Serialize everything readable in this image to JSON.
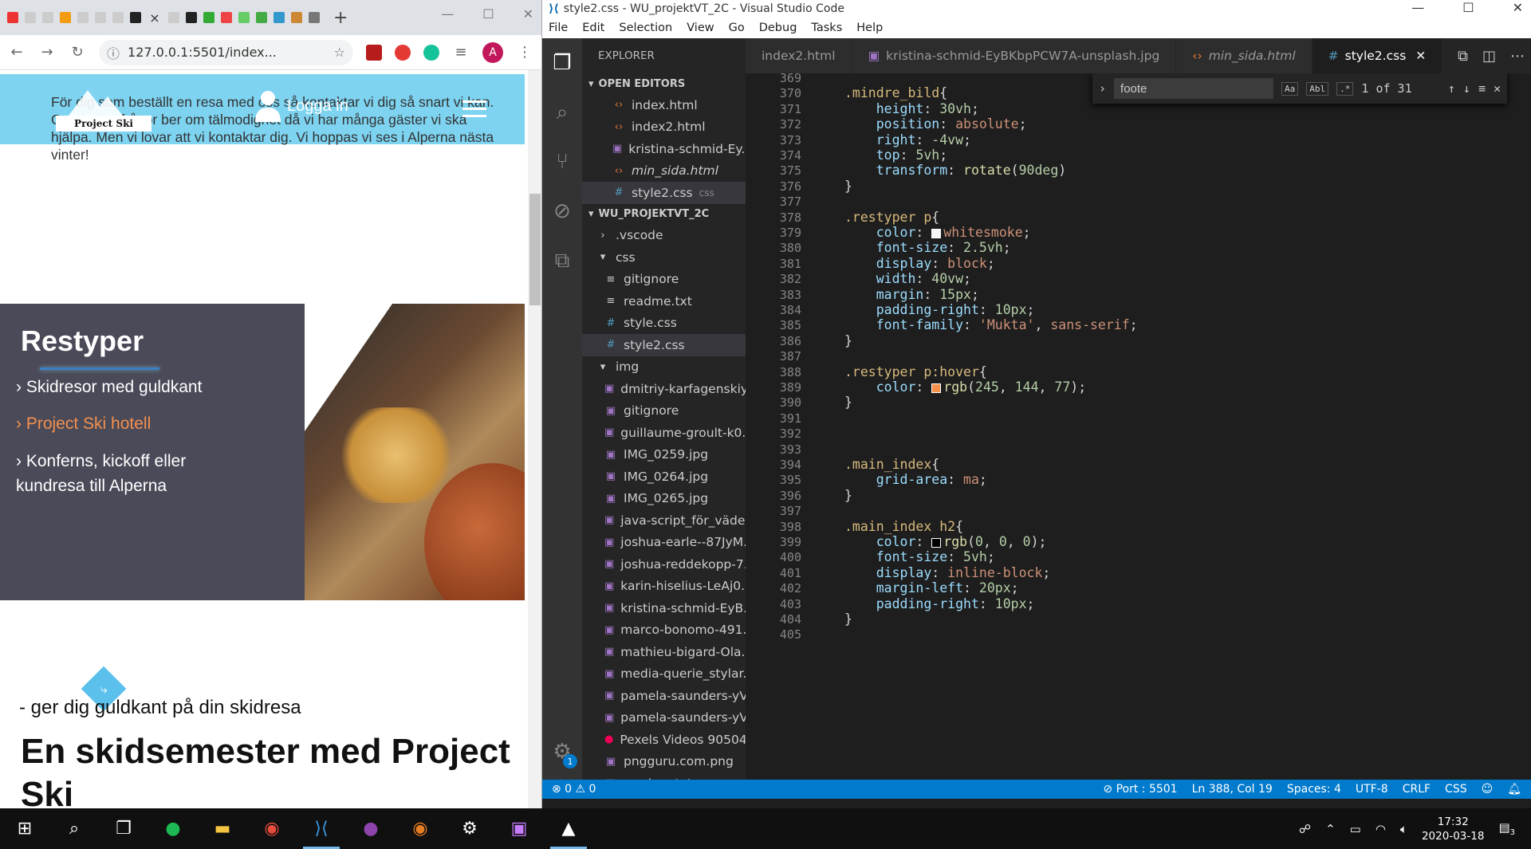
{
  "browser": {
    "url": "127.0.0.1:5501/index...",
    "account_initial": "A",
    "tab_close": "×",
    "new_tab": "+"
  },
  "page": {
    "top_text": "För dig som beställt en resa med oss så kontaktar vi dig så snart vi kan. Om du har frågor ber om tälmodighet då vi har många gäster vi ska hjälpa. Men vi lovar att vi kontaktar dig. Vi hoppas vi ses i Alperna nästa vinter!",
    "logo_text": "Project Ski",
    "login_label": "Logga in",
    "restyper_title": "Restyper",
    "restyper_items": [
      {
        "label": "Skidresor med guldkant",
        "color": "#ffffff"
      },
      {
        "label": "Project Ski hotell",
        "color": "#f5904d"
      },
      {
        "label": "Konferns, kickoff eller",
        "color": "#ffffff"
      },
      {
        "label": "kundresa till Alperna",
        "color": "#ffffff"
      }
    ],
    "tagline": "- ger dig guldkant på din skidresa",
    "headline": "En skidsemester med Project Ski"
  },
  "vscode": {
    "window_title": "style2.css - WU_projektVT_2C - Visual Studio Code",
    "menu": [
      "File",
      "Edit",
      "Selection",
      "View",
      "Go",
      "Debug",
      "Tasks",
      "Help"
    ],
    "explorer_title": "EXPLORER",
    "open_editors_label": "OPEN EDITORS",
    "project_label": "WU_PROJEKTVT_2C",
    "open_editors": [
      {
        "name": "index.html",
        "icon": "html"
      },
      {
        "name": "index2.html",
        "icon": "html"
      },
      {
        "name": "kristina-schmid-Ey...",
        "icon": "image"
      },
      {
        "name": "min_sida.html",
        "icon": "html"
      },
      {
        "name": "style2.css",
        "icon": "css",
        "hint": "css"
      }
    ],
    "tree": [
      {
        "name": ".vscode",
        "icon": "folder-closed",
        "indent": 1
      },
      {
        "name": "css",
        "icon": "folder-open",
        "indent": 1
      },
      {
        "name": "gitignore",
        "icon": "lines",
        "indent": 2
      },
      {
        "name": "readme.txt",
        "icon": "lines",
        "indent": 2
      },
      {
        "name": "style.css",
        "icon": "css",
        "indent": 2
      },
      {
        "name": "style2.css",
        "icon": "css",
        "indent": 2
      },
      {
        "name": "img",
        "icon": "folder-open",
        "indent": 1
      },
      {
        "name": "dmitriy-karfagenskiy...",
        "icon": "image",
        "indent": 2
      },
      {
        "name": "gitignore",
        "icon": "image",
        "indent": 2
      },
      {
        "name": "guillaume-groult-k0...",
        "icon": "image",
        "indent": 2
      },
      {
        "name": "IMG_0259.jpg",
        "icon": "image",
        "indent": 2
      },
      {
        "name": "IMG_0264.jpg",
        "icon": "image",
        "indent": 2
      },
      {
        "name": "IMG_0265.jpg",
        "icon": "image",
        "indent": 2
      },
      {
        "name": "java-script_för_väde...",
        "icon": "image",
        "indent": 2
      },
      {
        "name": "joshua-earle--87JyM...",
        "icon": "image",
        "indent": 2
      },
      {
        "name": "joshua-reddekopp-7...",
        "icon": "image",
        "indent": 2
      },
      {
        "name": "karin-hiselius-LeAj0...",
        "icon": "image",
        "indent": 2
      },
      {
        "name": "kristina-schmid-EyB...",
        "icon": "image",
        "indent": 2
      },
      {
        "name": "marco-bonomo-491...",
        "icon": "image",
        "indent": 2
      },
      {
        "name": "mathieu-bigard-Ola...",
        "icon": "image",
        "indent": 2
      },
      {
        "name": "media-querie_stylar...",
        "icon": "image",
        "indent": 2
      },
      {
        "name": "pamela-saunders-yV...",
        "icon": "image",
        "indent": 2
      },
      {
        "name": "pamela-saunders-yV...",
        "icon": "image",
        "indent": 2
      },
      {
        "name": "Pexels Videos 90504...",
        "icon": "video",
        "indent": 2
      },
      {
        "name": "pngguru.com.png",
        "icon": "image",
        "indent": 2
      },
      {
        "name": "readme.txt",
        "icon": "image",
        "indent": 2
      }
    ],
    "tabs": [
      {
        "label": "index2.html",
        "italic": false,
        "active": false
      },
      {
        "label": "kristina-schmid-EyBKbpPCW7A-unsplash.jpg",
        "italic": false,
        "active": false
      },
      {
        "label": "min_sida.html",
        "italic": true,
        "active": false
      },
      {
        "label": "style2.css",
        "italic": false,
        "active": true
      }
    ],
    "find": {
      "query": "foote",
      "result": "1 of 31",
      "opt_case": "Aa",
      "opt_word": "Abl",
      "opt_regex": ".*"
    },
    "code": [
      {
        "n": "369",
        "html": ""
      },
      {
        "n": "370",
        "html": "<span class='sel-c'>.mindre_bild</span>{"
      },
      {
        "n": "371",
        "html": "    <span class='prop'>height</span>: <span class='num'>30vh</span>;"
      },
      {
        "n": "372",
        "html": "    <span class='prop'>position</span>: <span class='val'>absolute</span>;"
      },
      {
        "n": "373",
        "html": "    <span class='prop'>right</span>: <span class='num'>-4vw</span>;"
      },
      {
        "n": "374",
        "html": "    <span class='prop'>top</span>: <span class='num'>5vh</span>;"
      },
      {
        "n": "375",
        "html": "    <span class='prop'>transform</span>: <span class='fn'>rotate</span>(<span class='num'>90deg</span>)"
      },
      {
        "n": "376",
        "html": "}"
      },
      {
        "n": "377",
        "html": ""
      },
      {
        "n": "378",
        "html": "<span class='sel-c'>.restyper p</span>{"
      },
      {
        "n": "379",
        "html": "    <span class='prop'>color</span>: <span class='sw' style='background:#f5f5f5'></span><span class='val'>whitesmoke</span>;"
      },
      {
        "n": "380",
        "html": "    <span class='prop'>font-size</span>: <span class='num'>2.5vh</span>;"
      },
      {
        "n": "381",
        "html": "    <span class='prop'>display</span>: <span class='val'>block</span>;"
      },
      {
        "n": "382",
        "html": "    <span class='prop'>width</span>: <span class='num'>40vw</span>;"
      },
      {
        "n": "383",
        "html": "    <span class='prop'>margin</span>: <span class='num'>15px</span>;"
      },
      {
        "n": "384",
        "html": "    <span class='prop'>padding-right</span>: <span class='num'>10px</span>;"
      },
      {
        "n": "385",
        "html": "    <span class='prop'>font-family</span>: <span class='val'>'Mukta'</span>, <span class='val'>sans-serif</span>;"
      },
      {
        "n": "386",
        "html": "}"
      },
      {
        "n": "387",
        "html": ""
      },
      {
        "n": "388",
        "html": "<span class='sel-c'>.restyper p:hover</span>{"
      },
      {
        "n": "389",
        "html": "    <span class='prop'>color</span>: <span class='sw' style='background:#f5904d'></span><span class='fn'>rgb</span>(<span class='num'>245</span>, <span class='num'>144</span>, <span class='num'>77</span>);"
      },
      {
        "n": "390",
        "html": "}"
      },
      {
        "n": "391",
        "html": ""
      },
      {
        "n": "392",
        "html": ""
      },
      {
        "n": "393",
        "html": ""
      },
      {
        "n": "394",
        "html": "<span class='sel-c'>.main_index</span>{"
      },
      {
        "n": "395",
        "html": "    <span class='prop'>grid-area</span>: <span class='val'>ma</span>;"
      },
      {
        "n": "396",
        "html": "}"
      },
      {
        "n": "397",
        "html": ""
      },
      {
        "n": "398",
        "html": "<span class='sel-c'>.main_index h2</span>{"
      },
      {
        "n": "399",
        "html": "    <span class='prop'>color</span>: <span class='sw' style='background:#000'></span><span class='fn'>rgb</span>(<span class='num'>0</span>, <span class='num'>0</span>, <span class='num'>0</span>);"
      },
      {
        "n": "400",
        "html": "    <span class='prop'>font-size</span>: <span class='num'>5vh</span>;"
      },
      {
        "n": "401",
        "html": "    <span class='prop'>display</span>: <span class='val'>inline-block</span>;"
      },
      {
        "n": "402",
        "html": "    <span class='prop'>margin-left</span>: <span class='num'>20px</span>;"
      },
      {
        "n": "403",
        "html": "    <span class='prop'>padding-right</span>: <span class='num'>10px</span>;"
      },
      {
        "n": "404",
        "html": "}"
      },
      {
        "n": "405",
        "html": ""
      }
    ],
    "status": {
      "errors": "⊗ 0 ⚠ 0",
      "port": "⊘ Port : 5501",
      "position": "Ln 388, Col 19",
      "spaces": "Spaces: 4",
      "encoding": "UTF-8",
      "eol": "CRLF",
      "language": "CSS"
    },
    "gear_badge": "1"
  },
  "taskbar": {
    "time": "17:32",
    "date": "2020-03-18",
    "notification_count": "3"
  }
}
